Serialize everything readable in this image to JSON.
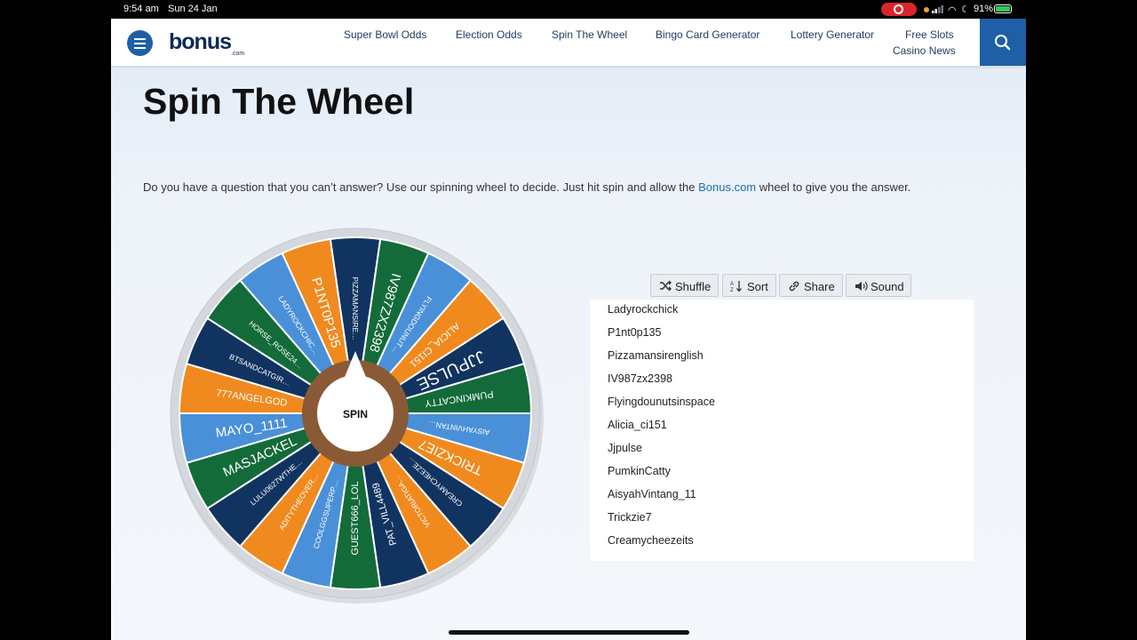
{
  "status_bar": {
    "time": "9:54 am",
    "date": "Sun 24 Jan",
    "battery": "91%"
  },
  "header": {
    "logo": "bonus",
    "logo_sub": ".com",
    "nav": [
      "Super Bowl Odds",
      "Election Odds",
      "Spin The Wheel",
      "Bingo Card Generator",
      "Lottery Generator",
      "Free Slots",
      "Casino News"
    ]
  },
  "page": {
    "title": "Spin The Wheel",
    "intro_before": "Do you have a question that you can’t answer? Use our spinning wheel to decide. Just hit spin and allow the ",
    "intro_link": "Bonus.com",
    "intro_after": " wheel to give you the answer."
  },
  "wheel": {
    "spin_label": "SPIN",
    "colors": {
      "blue": "#4a90d9",
      "orange": "#f08a1e",
      "navy": "#10335f",
      "green": "#136b3a",
      "rim": "#d4d8dc",
      "hub": "#8a5a36"
    },
    "segments": [
      {
        "label": "PIZZAMANSIRE…",
        "color": "navy",
        "size": "small"
      },
      {
        "label": "IV987ZX2398",
        "color": "green",
        "size": "large"
      },
      {
        "label": "FLYINGDOUNUT…",
        "color": "blue",
        "size": "small"
      },
      {
        "label": "ALICIA_CI151",
        "color": "orange",
        "size": "medium"
      },
      {
        "label": "JJPULSE",
        "color": "navy",
        "size": "xlarge"
      },
      {
        "label": "PUMKINCATTY",
        "color": "green",
        "size": "medium"
      },
      {
        "label": "AISYAHVINTAN…",
        "color": "blue",
        "size": "small"
      },
      {
        "label": "TRICKZIE7",
        "color": "orange",
        "size": "large"
      },
      {
        "label": "CREAMYCHEEZE…",
        "color": "navy",
        "size": "small"
      },
      {
        "label": "VICTORIATIGA…",
        "color": "orange",
        "size": "small"
      },
      {
        "label": "PAT_VILL4489",
        "color": "navy",
        "size": "medium"
      },
      {
        "label": "GUEST666_LOL",
        "color": "green",
        "size": "medium"
      },
      {
        "label": "COOLGGSUPERP…",
        "color": "blue",
        "size": "small"
      },
      {
        "label": "ADITYTHEOVER…",
        "color": "orange",
        "size": "small"
      },
      {
        "label": "LULU0627WTHE…",
        "color": "navy",
        "size": "small"
      },
      {
        "label": "MASJACKEL",
        "color": "green",
        "size": "large"
      },
      {
        "label": "MAYO_1111",
        "color": "blue",
        "size": "large"
      },
      {
        "label": "777ANGELGOD",
        "color": "orange",
        "size": "medium"
      },
      {
        "label": "BTSANDCATGIR…",
        "color": "navy",
        "size": "small"
      },
      {
        "label": "HORSE_ROSE24…",
        "color": "green",
        "size": "small"
      },
      {
        "label": "LADYROCKCHIC…",
        "color": "blue",
        "size": "small"
      },
      {
        "label": "P1NT0P135",
        "color": "orange",
        "size": "large"
      }
    ]
  },
  "controls": {
    "shuffle": "Shuffle",
    "sort": "Sort",
    "share": "Share",
    "sound": "Sound"
  },
  "entries": [
    "Ladyrockchick",
    "P1nt0p135",
    "Pizzamansirenglish",
    "IV987zx2398",
    "Flyingdounutsinspace",
    "Alicia_ci151",
    "Jjpulse",
    "PumkinCatty",
    "AisyahVintang_11",
    "Trickzie7",
    "Creamycheezeits"
  ]
}
